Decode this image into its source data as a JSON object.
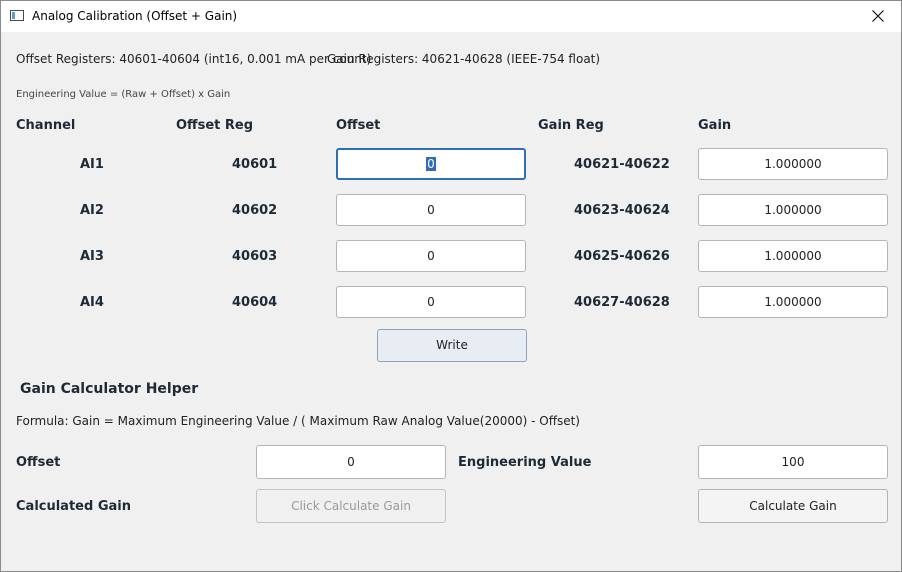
{
  "window": {
    "title": "Analog Calibration (Offset + Gain)"
  },
  "info": {
    "offset_registers": "Offset Registers: 40601-40604 (int16, 0.001 mA per count)",
    "gain_registers": "Gain Registers: 40621-40628 (IEEE-754 float)",
    "formula": "Engineering Value = (Raw + Offset) x Gain"
  },
  "table": {
    "headers": {
      "channel": "Channel",
      "offset_reg": "Offset Reg",
      "offset": "Offset",
      "gain_reg": "Gain Reg",
      "gain": "Gain"
    },
    "rows": [
      {
        "channel": "AI1",
        "offset_reg": "40601",
        "offset": "0",
        "gain_reg": "40621-40622",
        "gain": "1.000000"
      },
      {
        "channel": "AI2",
        "offset_reg": "40602",
        "offset": "0",
        "gain_reg": "40623-40624",
        "gain": "1.000000"
      },
      {
        "channel": "AI3",
        "offset_reg": "40603",
        "offset": "0",
        "gain_reg": "40625-40626",
        "gain": "1.000000"
      },
      {
        "channel": "AI4",
        "offset_reg": "40604",
        "offset": "0",
        "gain_reg": "40627-40628",
        "gain": "1.000000"
      }
    ]
  },
  "write_label": "Write",
  "helper": {
    "title": "Gain Calculator Helper",
    "formula": "Formula: Gain = Maximum Engineering Value / ( Maximum Raw Analog Value(20000) - Offset)",
    "offset_label": "Offset",
    "offset_value": "0",
    "eng_label": "Engineering Value",
    "eng_value": "100",
    "calc_gain_label": "Calculated Gain",
    "calc_gain_value": "Click Calculate Gain",
    "calc_button": "Calculate Gain"
  },
  "icons": {
    "app": "app-window-icon",
    "close": "close-icon"
  }
}
